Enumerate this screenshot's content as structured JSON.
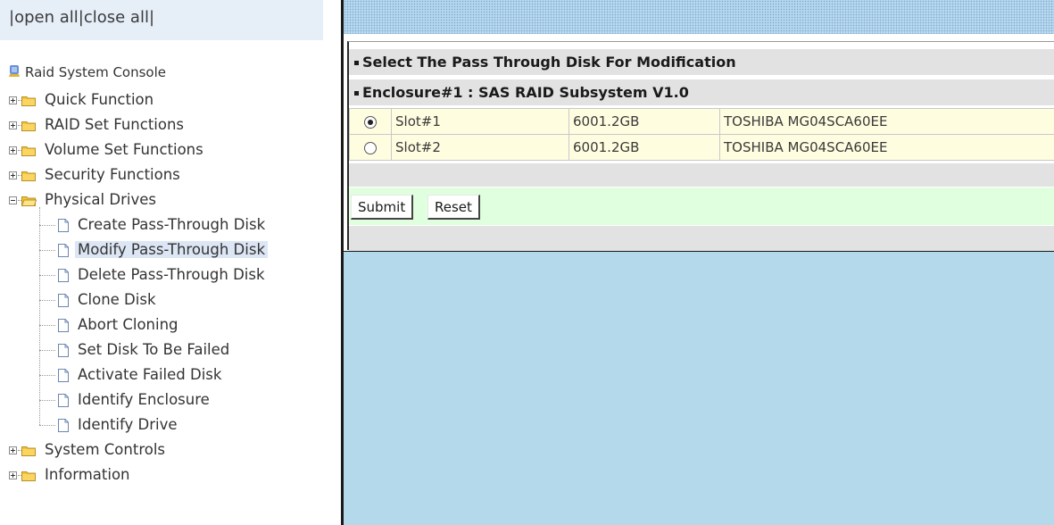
{
  "nav": {
    "open_all": "open all",
    "close_all": "close all",
    "separator": "|",
    "root_label": "Raid System Console",
    "items": [
      {
        "label": "Quick Function",
        "expanded": false
      },
      {
        "label": "RAID Set Functions",
        "expanded": false
      },
      {
        "label": "Volume Set Functions",
        "expanded": false
      },
      {
        "label": "Security Functions",
        "expanded": false
      },
      {
        "label": "Physical Drives",
        "expanded": true,
        "children": [
          "Create Pass-Through Disk",
          "Modify Pass-Through Disk",
          "Delete Pass-Through Disk",
          "Clone Disk",
          "Abort Cloning",
          "Set Disk To Be Failed",
          "Activate Failed Disk",
          "Identify Enclosure",
          "Identify Drive"
        ],
        "selected_child": "Modify Pass-Through Disk"
      },
      {
        "label": "System Controls",
        "expanded": false
      },
      {
        "label": "Information",
        "expanded": false
      }
    ]
  },
  "main": {
    "section_title": "Select The Pass Through Disk For Modification",
    "enclosure_title": "Enclosure#1 : SAS RAID Subsystem V1.0",
    "disks": [
      {
        "selected": true,
        "slot": "Slot#1",
        "capacity": "6001.2GB",
        "model": "TOSHIBA MG04SCA60EE"
      },
      {
        "selected": false,
        "slot": "Slot#2",
        "capacity": "6001.2GB",
        "model": "TOSHIBA MG04SCA60EE"
      }
    ],
    "submit_label": "Submit",
    "reset_label": "Reset"
  },
  "colors": {
    "main_background": "#b3d9ea",
    "row_background": "#fffde0",
    "button_row_background": "#dfffdf",
    "folder": "#f4c430"
  }
}
